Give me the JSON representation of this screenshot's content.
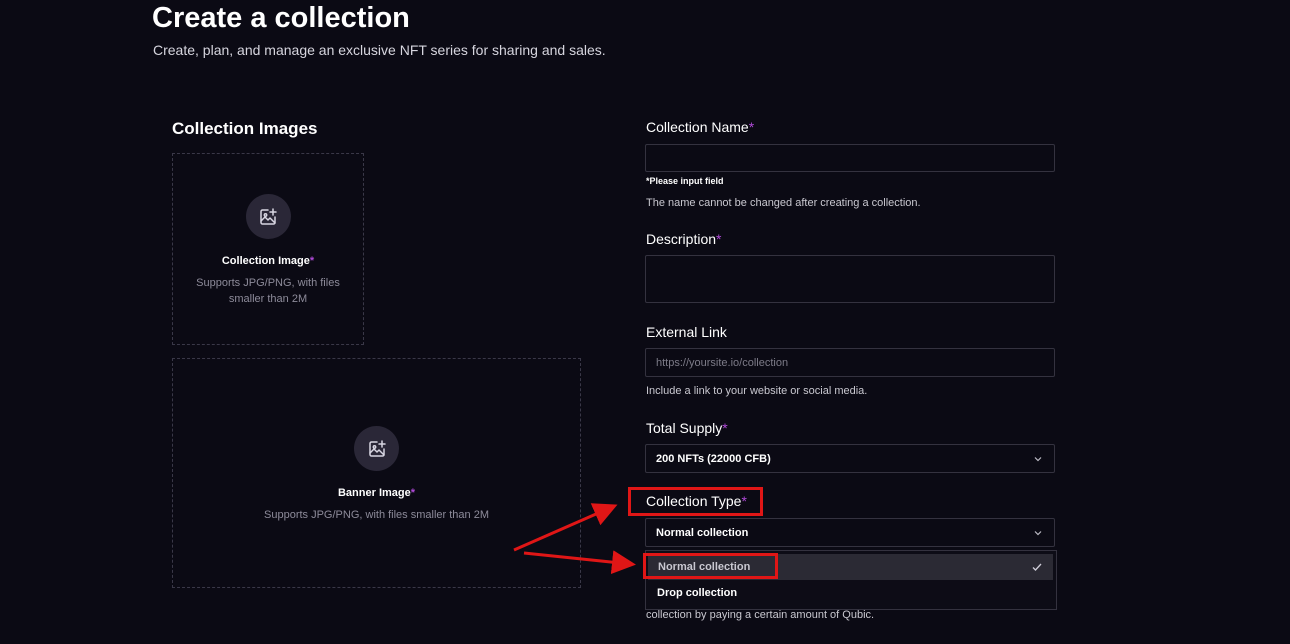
{
  "header": {
    "title": "Create a collection",
    "subtitle": "Create, plan, and manage an exclusive NFT series for sharing and sales."
  },
  "images_section": {
    "title": "Collection Images",
    "collection_image": {
      "label": "Collection Image",
      "required_mark": "*",
      "hint": "Supports JPG/PNG, with files smaller than 2M",
      "icon": "image-plus-icon"
    },
    "banner_image": {
      "label": "Banner Image",
      "required_mark": "*",
      "hint": "Supports JPG/PNG, with files smaller than 2M",
      "icon": "image-plus-icon"
    }
  },
  "form": {
    "collection_name": {
      "label": "Collection Name",
      "required_mark": "*",
      "value": "",
      "error": "*Please input field",
      "help": "The name cannot be changed after creating a collection."
    },
    "description": {
      "label": "Description",
      "required_mark": "*",
      "value": ""
    },
    "external_link": {
      "label": "External Link",
      "placeholder": "https://yoursite.io/collection",
      "help": "Include a link to your website or social media."
    },
    "total_supply": {
      "label": "Total Supply",
      "required_mark": "*",
      "value": "200 NFTs (22000 CFB)"
    },
    "collection_type": {
      "label": "Collection Type",
      "required_mark": "*",
      "value": "Normal collection",
      "options": [
        "Normal collection",
        "Drop collection"
      ],
      "help_partial": "collection by paying a certain amount of Qubic."
    }
  },
  "colors": {
    "background": "#0b0a14",
    "required": "#b04ad8",
    "annotation": "#e01616"
  }
}
